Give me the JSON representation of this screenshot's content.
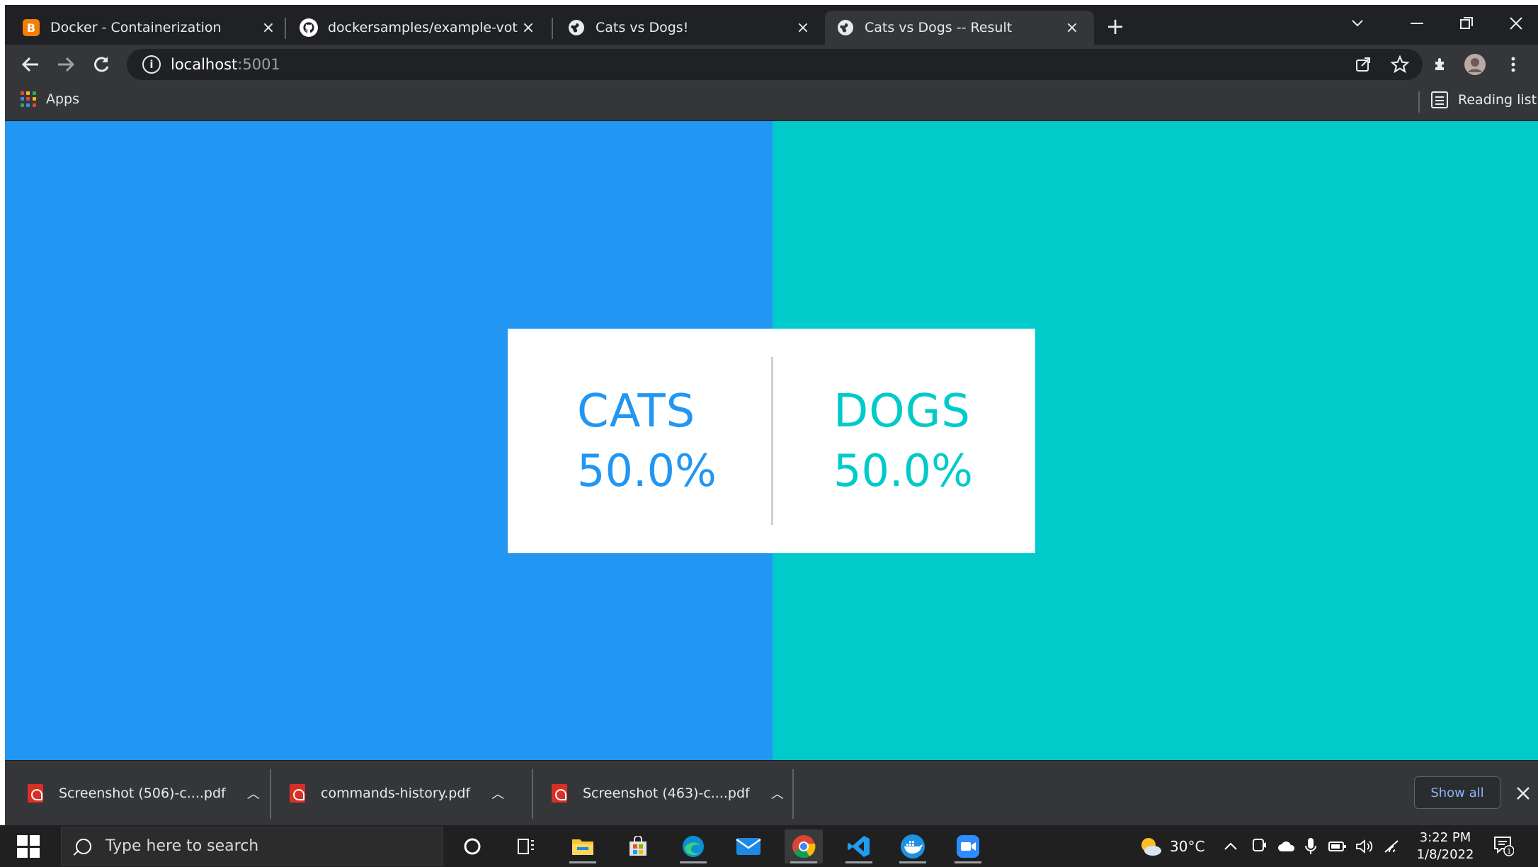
{
  "browser": {
    "tabs": [
      {
        "title": "Docker - Containerization",
        "icon": "blogger-icon",
        "active": false
      },
      {
        "title": "dockersamples/example-voting-a",
        "icon": "github-icon",
        "active": false
      },
      {
        "title": "Cats vs Dogs!",
        "icon": "globe-icon",
        "active": false
      },
      {
        "title": "Cats vs Dogs -- Result",
        "icon": "globe-icon",
        "active": true
      }
    ],
    "new_tab_label": "+",
    "close_glyph": "×",
    "address": {
      "host": "localhost",
      "port": ":5001"
    },
    "bookmarks": {
      "apps_label": "Apps",
      "reading_list_label": "Reading list"
    }
  },
  "page": {
    "colors": {
      "cats": "#2196f3",
      "dogs": "#00cbca",
      "card": "#ffffff"
    },
    "result": {
      "cats": {
        "label": "CATS",
        "percent": "50.0%"
      },
      "dogs": {
        "label": "DOGS",
        "percent": "50.0%"
      }
    }
  },
  "downloads": {
    "items": [
      {
        "name": "Screenshot (506)-c....pdf"
      },
      {
        "name": "commands-history.pdf"
      },
      {
        "name": "Screenshot (463)-c....pdf"
      }
    ],
    "show_all_label": "Show all"
  },
  "taskbar": {
    "search_placeholder": "Type here to search",
    "weather": "30°C",
    "time": "3:22 PM",
    "date": "1/8/2022",
    "notification_count": "1",
    "apps": [
      "cortana-icon",
      "task-view-icon",
      "file-explorer-icon",
      "store-icon",
      "edge-icon",
      "mail-icon",
      "chrome-icon",
      "vscode-icon",
      "docker-icon",
      "zoom-icon"
    ]
  }
}
